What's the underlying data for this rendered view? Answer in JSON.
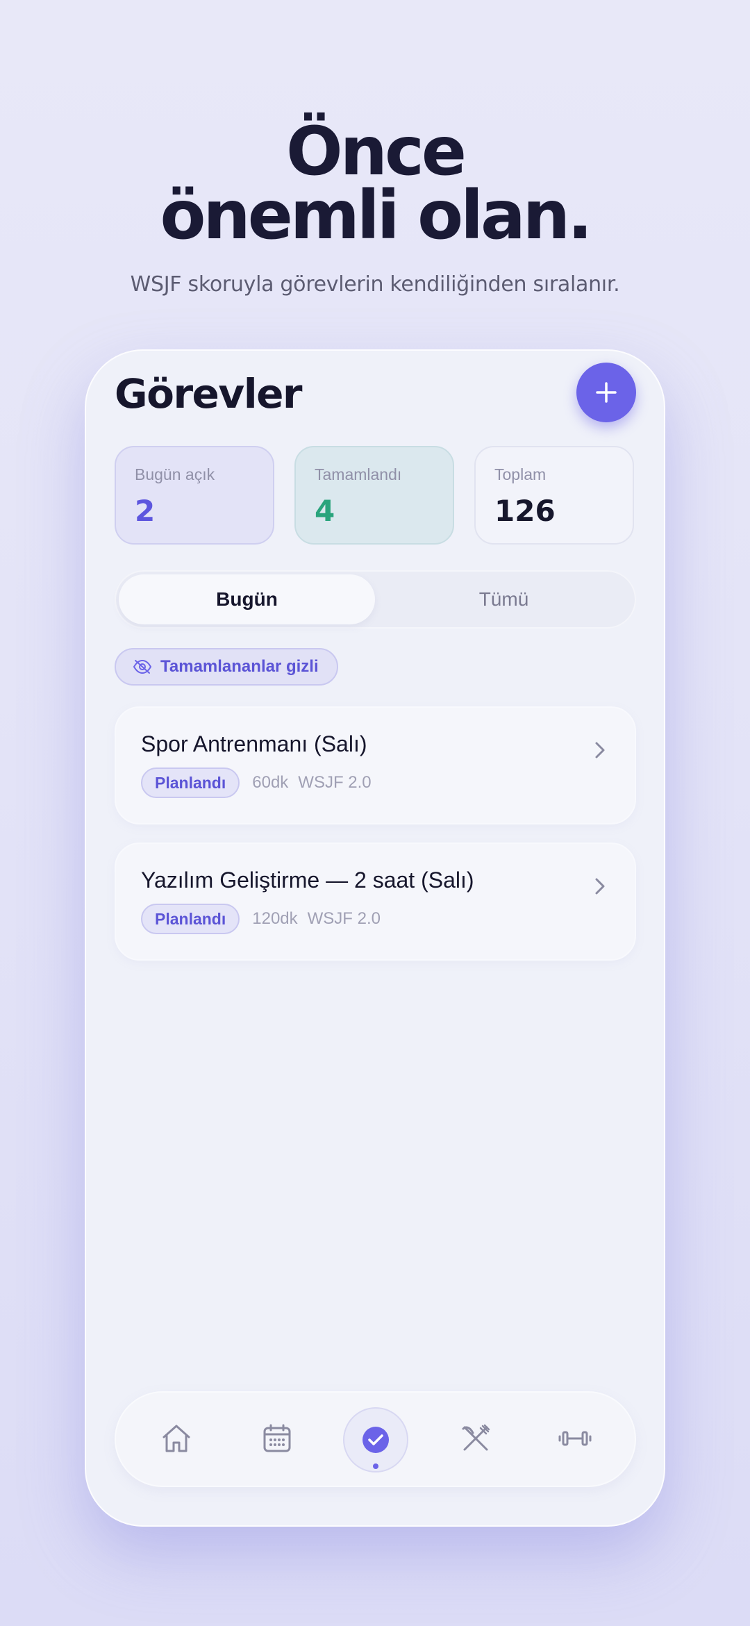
{
  "hero": {
    "title_line1": "Önce",
    "title_line2": "önemli olan.",
    "subtitle": "WSJF skoruyla görevlerin kendiliğinden sıralanır."
  },
  "screen": {
    "title": "Görevler",
    "add_icon": "plus-icon"
  },
  "stats": [
    {
      "label": "Bugün açık",
      "value": "2",
      "color": "#5d56de"
    },
    {
      "label": "Tamamlandı",
      "value": "4",
      "color": "#29a47c"
    },
    {
      "label": "Toplam",
      "value": "126",
      "color": "#16162c"
    }
  ],
  "segments": {
    "active": "Bugün",
    "inactive": "Tümü"
  },
  "filter_chip": {
    "icon": "eye-off-icon",
    "label": "Tamamlananlar gizli"
  },
  "tasks": [
    {
      "title": "Spor Antrenmanı (Salı)",
      "status": "Planlandı",
      "duration": "60dk",
      "wsjf": "WSJF 2.0"
    },
    {
      "title": "Yazılım Geliştirme — 2 saat (Salı)",
      "status": "Planlandı",
      "duration": "120dk",
      "wsjf": "WSJF 2.0"
    }
  ],
  "nav": {
    "items": [
      "home-icon",
      "calendar-icon",
      "tasks-check-icon",
      "fork-knife-icon",
      "dumbbell-icon"
    ],
    "active": "tasks-check-icon"
  },
  "colors": {
    "accent": "#6b63e8",
    "success": "#29a47c",
    "text_dark": "#16162c"
  }
}
